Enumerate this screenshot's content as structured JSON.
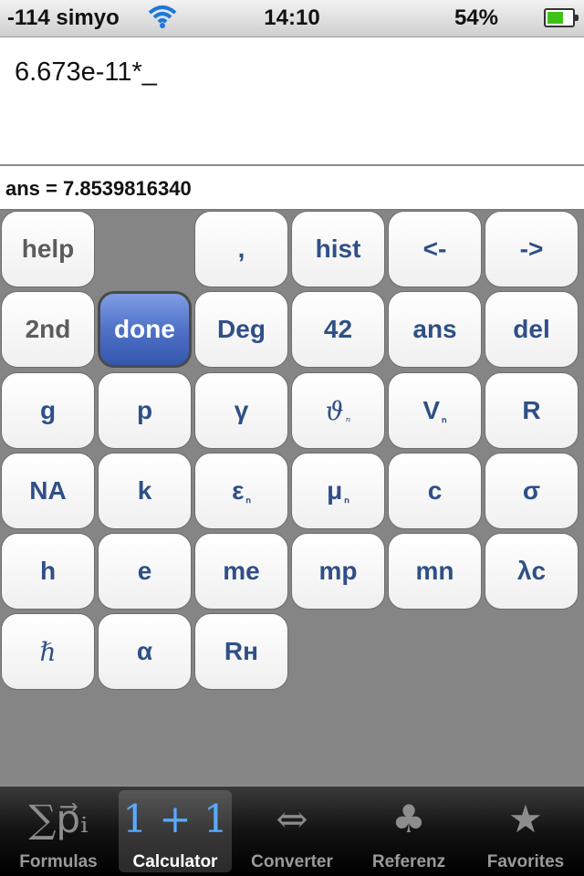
{
  "statusbar": {
    "carrier": "-114 simyo",
    "time": "14:10",
    "battery": "54%"
  },
  "display": {
    "expression": "6.673e-11*_",
    "answer": "ans = 7.8539816340"
  },
  "keys": {
    "help": "help",
    "comma": ",",
    "hist": "hist",
    "left": "<-",
    "right": "->",
    "second": "2nd",
    "done": "done",
    "deg": "Deg",
    "k42": "42",
    "ans": "ans",
    "del": "del",
    "g": "g",
    "p": "p",
    "gamma": "γ",
    "theta": "ϑ",
    "theta_sub": "ₙ",
    "V": "V",
    "V_sub": "ₙ",
    "R": "R",
    "NA": "NA",
    "k": "k",
    "eps": "ε",
    "eps_sub": "ₙ",
    "mu": "μ",
    "mu_sub": "ₙ",
    "c": "c",
    "sigma": "σ",
    "h": "h",
    "e": "e",
    "me": "me",
    "mp": "mp",
    "mn": "mn",
    "lc": "λc",
    "hbar": "ℏ",
    "alpha": "α",
    "RH": "Rʜ"
  },
  "tabs": {
    "formulas": {
      "label": "Formulas",
      "icon": "∑p⃗ᵢ"
    },
    "calculator": {
      "label": "Calculator",
      "icon": "1 + 1"
    },
    "converter": {
      "label": "Converter",
      "icon": "⇔"
    },
    "referenz": {
      "label": "Referenz",
      "icon": "♣"
    },
    "favorites": {
      "label": "Favorites",
      "icon": "★"
    }
  },
  "colors": {
    "key_text": "#2f4f87",
    "done_bg": "#4f72c8",
    "active_tab": "#5aa9ff"
  }
}
